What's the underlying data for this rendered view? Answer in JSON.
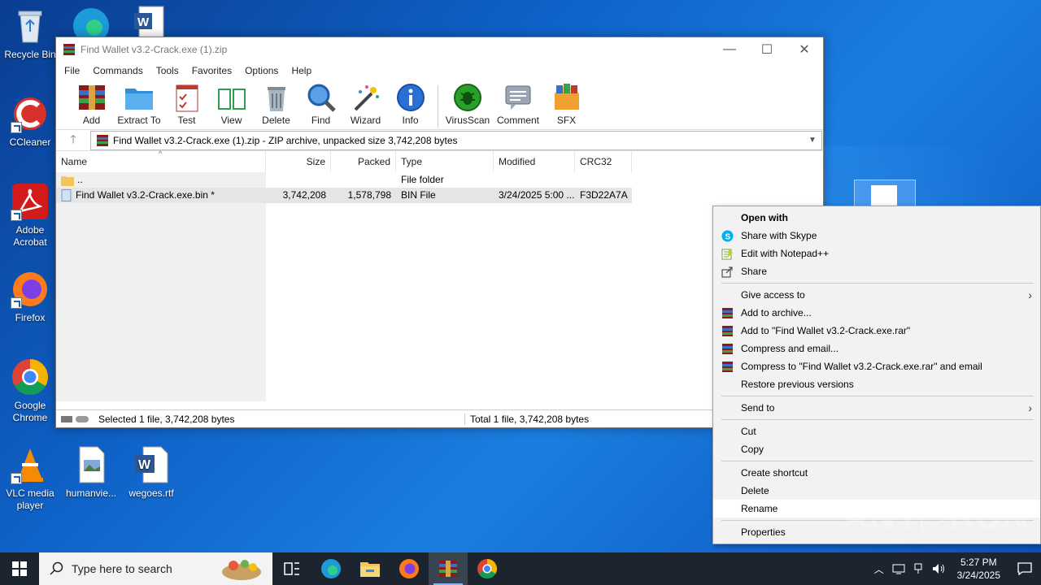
{
  "desktop": {
    "icons": [
      {
        "label": "Recycle Bin"
      },
      {
        "label": "CCleaner"
      },
      {
        "label": "Adobe Acrobat"
      },
      {
        "label": "Firefox"
      },
      {
        "label": "Google Chrome"
      },
      {
        "label": "VLC media player"
      },
      {
        "label": "humanvie..."
      },
      {
        "label": "wegoes.rtf"
      }
    ]
  },
  "window": {
    "title": "Find Wallet v3.2-Crack.exe (1).zip",
    "controls": {
      "minimize": "—",
      "maximize": "☐",
      "close": "✕"
    },
    "menu": [
      "File",
      "Commands",
      "Tools",
      "Favorites",
      "Options",
      "Help"
    ],
    "toolbar": [
      "Add",
      "Extract To",
      "Test",
      "View",
      "Delete",
      "Find",
      "Wizard",
      "Info",
      "VirusScan",
      "Comment",
      "SFX"
    ],
    "path": "Find Wallet v3.2-Crack.exe (1).zip - ZIP archive, unpacked size 3,742,208 bytes",
    "columns": [
      "Name",
      "Size",
      "Packed",
      "Type",
      "Modified",
      "CRC32"
    ],
    "rows": [
      {
        "name": "..",
        "size": "",
        "packed": "",
        "type": "File folder",
        "modified": "",
        "crc": ""
      },
      {
        "name": "Find Wallet v3.2-Crack.exe.bin *",
        "size": "3,742,208",
        "packed": "1,578,798",
        "type": "BIN File",
        "modified": "3/24/2025 5:00 ...",
        "crc": "F3D22A7A"
      }
    ],
    "status_left": "Selected 1 file, 3,742,208 bytes",
    "status_right": "Total 1 file, 3,742,208 bytes"
  },
  "context_menu": {
    "items": [
      {
        "label": "Open with",
        "icon": "none",
        "bold": true
      },
      {
        "label": "Share with Skype",
        "icon": "skype-icon"
      },
      {
        "label": "Edit with Notepad++",
        "icon": "notepadpp-icon"
      },
      {
        "label": "Share",
        "icon": "share-icon"
      },
      {
        "label": "Give access to",
        "icon": "none",
        "submenu": true
      },
      {
        "label": "Add to archive...",
        "icon": "winrar-icon"
      },
      {
        "label": "Add to \"Find Wallet v3.2-Crack.exe.rar\"",
        "icon": "winrar-icon"
      },
      {
        "label": "Compress and email...",
        "icon": "winrar-icon"
      },
      {
        "label": "Compress to \"Find Wallet v3.2-Crack.exe.rar\" and email",
        "icon": "winrar-icon"
      },
      {
        "label": "Restore previous versions",
        "icon": "none"
      },
      {
        "label": "Send to",
        "icon": "none",
        "submenu": true
      },
      {
        "label": "Cut",
        "icon": "none"
      },
      {
        "label": "Copy",
        "icon": "none"
      },
      {
        "label": "Create shortcut",
        "icon": "none"
      },
      {
        "label": "Delete",
        "icon": "none"
      },
      {
        "label": "Rename",
        "icon": "none",
        "hover": true
      },
      {
        "label": "Properties",
        "icon": "none"
      }
    ],
    "submenu_arrow": "›"
  },
  "taskbar": {
    "search_placeholder": "Type here to search",
    "time": "5:27 PM",
    "date": "3/24/2025"
  },
  "watermark": "ANY▷RUN",
  "colors": {
    "desktop": "#0f62c8",
    "taskbar": "#1c2430",
    "menu_bg": "#f2f2f2"
  }
}
